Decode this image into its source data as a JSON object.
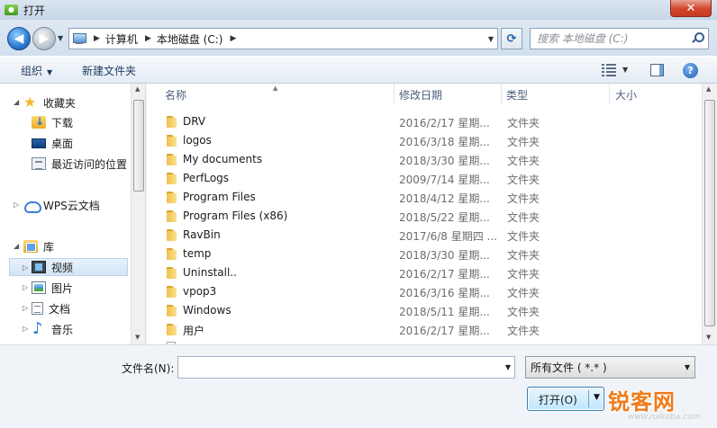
{
  "window": {
    "title": "打开",
    "close_symbol": "✕"
  },
  "nav": {
    "back_symbol": "◀",
    "forward_symbol": "▶",
    "breadcrumb": [
      "计算机",
      "本地磁盘 (C:)"
    ],
    "refresh_symbol": "⟳",
    "search_placeholder": "搜索 本地磁盘 (C:)"
  },
  "toolbar": {
    "organize_label": "组织",
    "new_folder_label": "新建文件夹",
    "help_symbol": "?"
  },
  "sidebar": {
    "items": [
      {
        "label": "收藏夹",
        "icon": "star-icon"
      },
      {
        "label": "下载",
        "icon": "downloads-folder-icon"
      },
      {
        "label": "桌面",
        "icon": "desktop-icon"
      },
      {
        "label": "最近访问的位置",
        "icon": "recent-places-icon"
      },
      {
        "label": "WPS云文档",
        "icon": "cloud-icon"
      },
      {
        "label": "库",
        "icon": "libraries-icon"
      },
      {
        "label": "视频",
        "icon": "videos-icon"
      },
      {
        "label": "图片",
        "icon": "pictures-icon"
      },
      {
        "label": "文档",
        "icon": "documents-icon"
      },
      {
        "label": "音乐",
        "icon": "music-icon"
      }
    ]
  },
  "file_list": {
    "columns": [
      "名称",
      "修改日期",
      "类型",
      "大小"
    ],
    "rows": [
      {
        "name": "DRV",
        "date": "2016/2/17 星期...",
        "type": "文件夹"
      },
      {
        "name": "logos",
        "date": "2016/3/18 星期...",
        "type": "文件夹"
      },
      {
        "name": "My documents",
        "date": "2018/3/30 星期...",
        "type": "文件夹"
      },
      {
        "name": "PerfLogs",
        "date": "2009/7/14 星期...",
        "type": "文件夹"
      },
      {
        "name": "Program Files",
        "date": "2018/4/12 星期...",
        "type": "文件夹"
      },
      {
        "name": "Program Files (x86)",
        "date": "2018/5/22 星期...",
        "type": "文件夹"
      },
      {
        "name": "RavBin",
        "date": "2017/6/8 星期四 ...",
        "type": "文件夹"
      },
      {
        "name": "temp",
        "date": "2018/3/30 星期...",
        "type": "文件夹"
      },
      {
        "name": "Uninstall..",
        "date": "2016/2/17 星期...",
        "type": "文件夹"
      },
      {
        "name": "vpop3",
        "date": "2016/3/16 星期...",
        "type": "文件夹"
      },
      {
        "name": "Windows",
        "date": "2018/5/11 星期...",
        "type": "文件夹"
      },
      {
        "name": "用户",
        "date": "2016/2/17 星期...",
        "type": "文件夹"
      }
    ]
  },
  "footer": {
    "filename_label": "文件名(N):",
    "filename_value": "",
    "filter_value": "所有文件 ( *.* )",
    "open_label": "打开(O)"
  },
  "watermark": {
    "brand": "锐客网",
    "url": "www.ruikeba.com"
  }
}
